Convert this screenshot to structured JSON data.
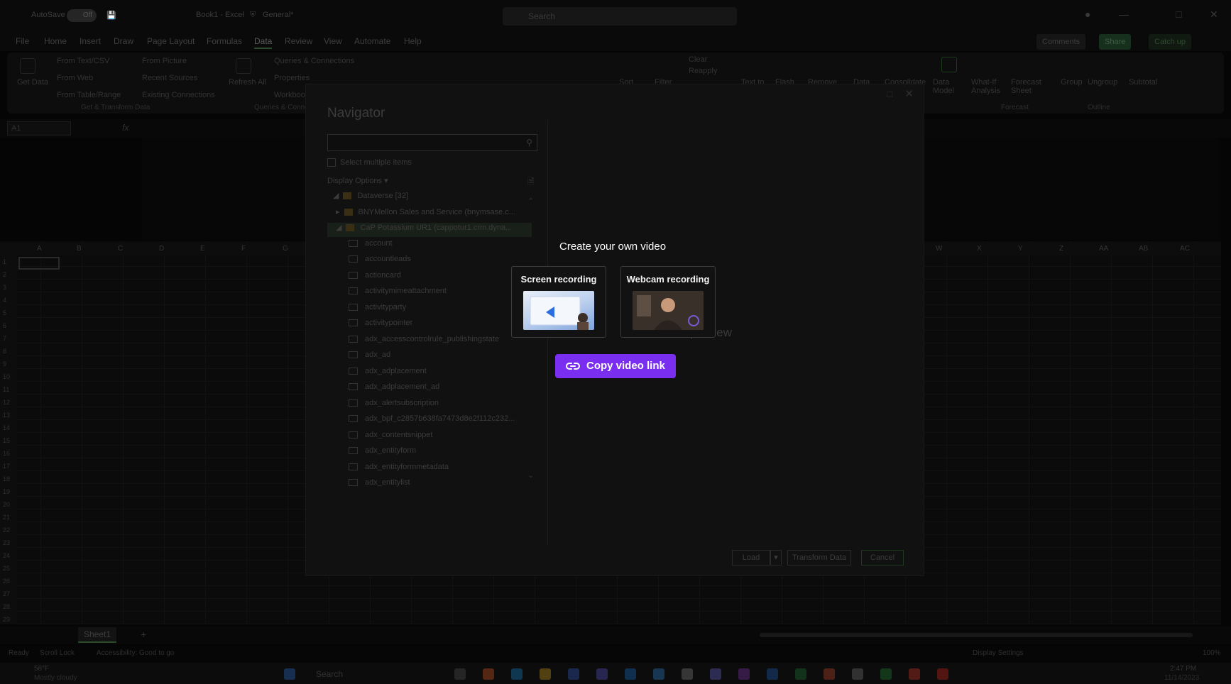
{
  "titlebar": {
    "autosave_label": "AutoSave",
    "autosave_state": "Off",
    "doc_title": "Book1 - Excel",
    "sensitivity": "General*",
    "search_placeholder": "Search"
  },
  "menu": {
    "items": [
      "File",
      "Home",
      "Insert",
      "Draw",
      "Page Layout",
      "Formulas",
      "Data",
      "Review",
      "View",
      "Automate",
      "Help"
    ],
    "active": "Data",
    "comments": "Comments",
    "share": "Share",
    "catch_up": "Catch up"
  },
  "ribbon": {
    "get_data": "Get Data",
    "from_text_csv": "From Text/CSV",
    "from_web": "From Web",
    "from_table_range": "From Table/Range",
    "from_picture": "From Picture",
    "recent_sources": "Recent Sources",
    "existing_connections": "Existing Connections",
    "group_get_transform": "Get & Transform Data",
    "refresh_all": "Refresh All",
    "queries_connections": "Queries & Connections",
    "properties": "Properties",
    "workbook_links": "Workbook Links",
    "group_queries": "Queries & Connections",
    "sort": "Sort",
    "filter": "Filter",
    "clear": "Clear",
    "reapply": "Reapply",
    "text_to": "Text to",
    "flash": "Flash",
    "remove": "Remove",
    "data": "Data",
    "consolidate": "Consolidate",
    "data_model": "Data Model",
    "what_if": "What-If Analysis",
    "forecast_sheet": "Forecast Sheet",
    "group_forecast": "Forecast",
    "group": "Group",
    "ungroup": "Ungroup",
    "subtotal": "Subtotal",
    "group_outline": "Outline"
  },
  "formula_bar": {
    "name_box": "A1",
    "fx": "fx"
  },
  "grid": {
    "columns": [
      "A",
      "B",
      "C",
      "D",
      "E",
      "F",
      "G",
      "W",
      "X",
      "Y",
      "Z",
      "AA",
      "AB",
      "AC"
    ],
    "rows": [
      "1",
      "2",
      "3",
      "4",
      "5",
      "6",
      "7",
      "8",
      "9",
      "10",
      "11",
      "12",
      "13",
      "14",
      "15",
      "16",
      "17",
      "18",
      "19",
      "20",
      "21",
      "22",
      "23",
      "24",
      "25",
      "26",
      "27",
      "28",
      "29"
    ]
  },
  "sheet": {
    "tab": "Sheet1"
  },
  "status": {
    "ready": "Ready",
    "scroll_lock": "Scroll Lock",
    "accessibility": "Accessibility: Good to go",
    "display_settings": "Display Settings",
    "zoom": "100%"
  },
  "taskbar": {
    "weather_temp": "58°F",
    "weather_desc": "Mostly cloudy",
    "search": "Search",
    "time": "2:47 PM",
    "date": "11/14/2023"
  },
  "navigator": {
    "title": "Navigator",
    "select_multiple": "Select multiple items",
    "display_options": "Display Options",
    "tree": [
      {
        "label": "Dataverse [32]",
        "level": 0,
        "kind": "folder"
      },
      {
        "label": "BNYMellon Sales and Service (bnymsase.c...",
        "level": 1,
        "kind": "db"
      },
      {
        "label": "CaP Potassium UR1 (cappotur1.crm.dyna...",
        "level": 1,
        "kind": "db",
        "selected": true
      },
      {
        "label": "account",
        "level": 2,
        "kind": "table"
      },
      {
        "label": "accountleads",
        "level": 2,
        "kind": "table"
      },
      {
        "label": "actioncard",
        "level": 2,
        "kind": "table"
      },
      {
        "label": "activitymimeattachment",
        "level": 2,
        "kind": "table"
      },
      {
        "label": "activityparty",
        "level": 2,
        "kind": "table"
      },
      {
        "label": "activitypointer",
        "level": 2,
        "kind": "table"
      },
      {
        "label": "adx_accesscontrolrule_publishingstate",
        "level": 2,
        "kind": "table"
      },
      {
        "label": "adx_ad",
        "level": 2,
        "kind": "table"
      },
      {
        "label": "adx_adplacement",
        "level": 2,
        "kind": "table"
      },
      {
        "label": "adx_adplacement_ad",
        "level": 2,
        "kind": "table"
      },
      {
        "label": "adx_alertsubscription",
        "level": 2,
        "kind": "table"
      },
      {
        "label": "adx_bpf_c2857b638fa7473d8e2f112c232...",
        "level": 2,
        "kind": "table"
      },
      {
        "label": "adx_contentsnippet",
        "level": 2,
        "kind": "table"
      },
      {
        "label": "adx_entityform",
        "level": 2,
        "kind": "table"
      },
      {
        "label": "adx_entityformmetadata",
        "level": 2,
        "kind": "table"
      },
      {
        "label": "adx_entitylist",
        "level": 2,
        "kind": "table"
      }
    ],
    "preview_text": "cted for preview",
    "load": "Load",
    "transform": "Transform Data",
    "cancel": "Cancel"
  },
  "video_overlay": {
    "title": "Create your own video",
    "screen_recording": "Screen recording",
    "webcam_recording": "Webcam recording",
    "copy_link": "Copy video link",
    "accent": "#7a2ff0"
  }
}
